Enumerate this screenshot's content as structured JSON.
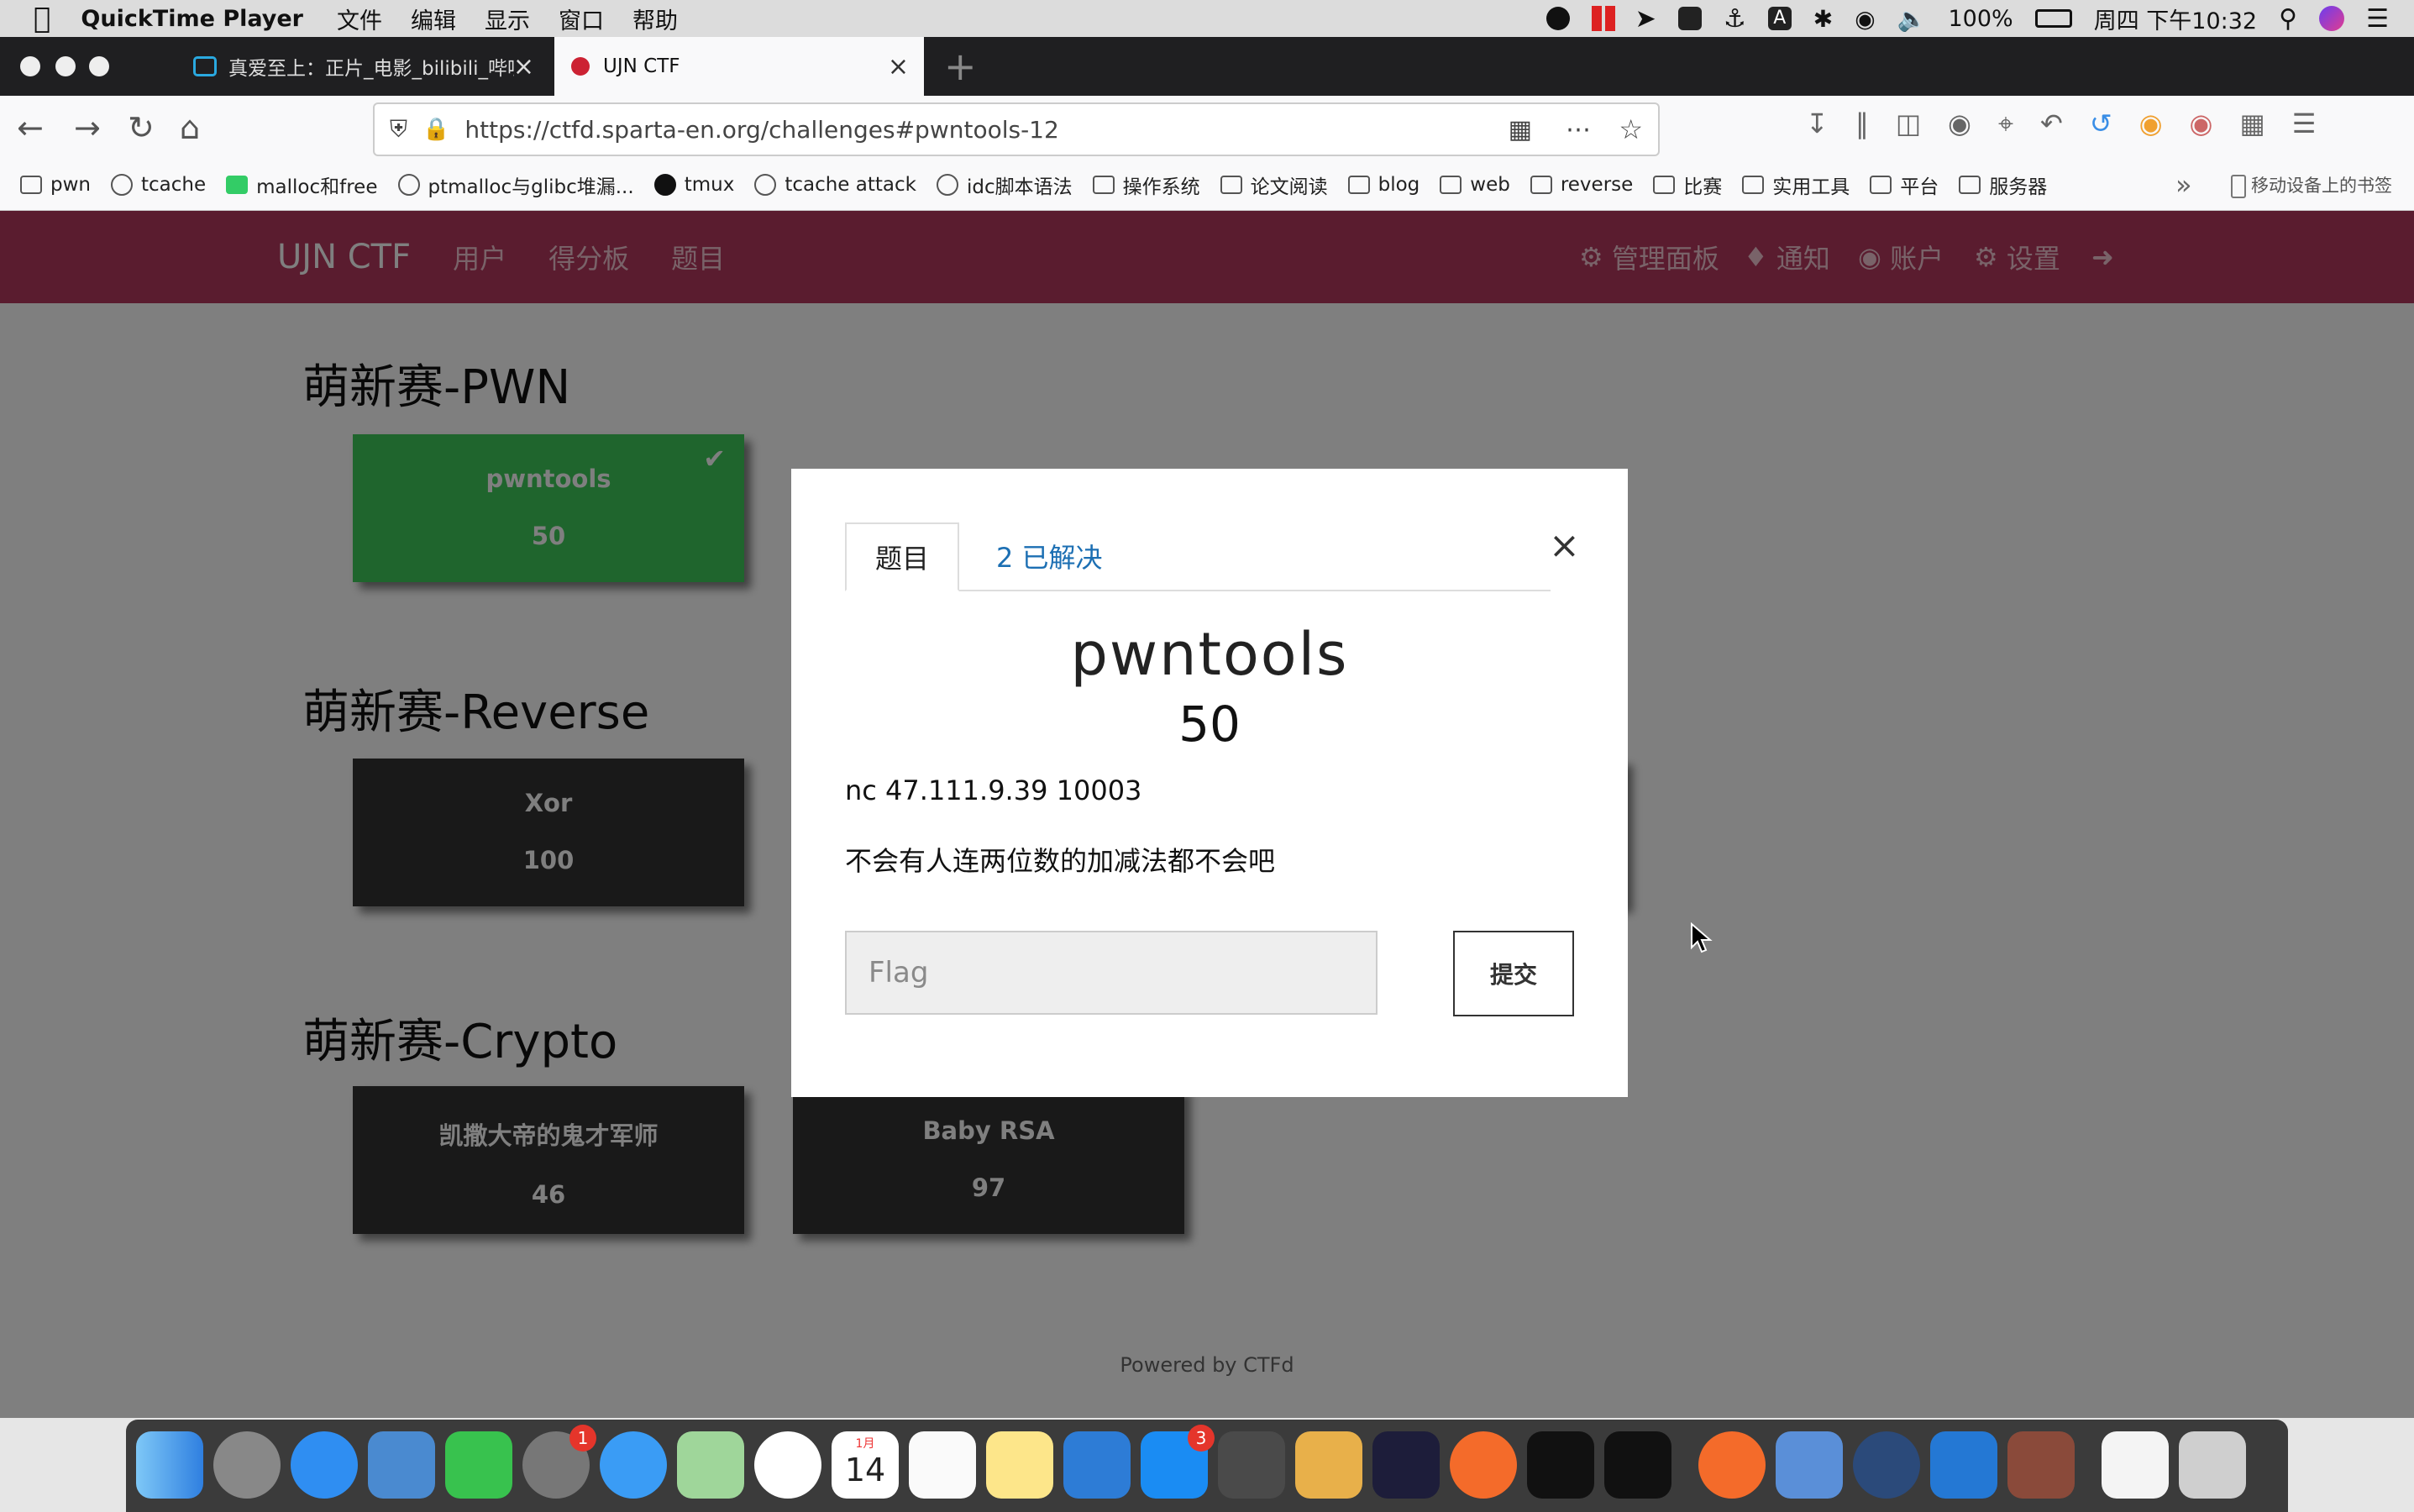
{
  "menubar": {
    "app_name": "QuickTime Player",
    "menus": [
      "文件",
      "编辑",
      "显示",
      "窗口",
      "帮助"
    ],
    "battery": "100%",
    "clock": "周四 下午10:32"
  },
  "browser": {
    "tabs": [
      {
        "label": "真爱至上：正片_电影_bilibili_哔哩"
      },
      {
        "label": "UJN CTF"
      }
    ],
    "url": "https://ctfd.sparta-en.org/challenges#pwntools-12",
    "bookmarks": [
      "pwn",
      "tcache",
      "malloc和free",
      "ptmalloc与glibc堆漏...",
      "tmux",
      "tcache attack",
      "idc脚本语法",
      "操作系统",
      "论文阅读",
      "blog",
      "web",
      "reverse",
      "比赛",
      "实用工具",
      "平台",
      "服务器"
    ],
    "mobile_bookmarks": "移动设备上的书签"
  },
  "ctf": {
    "brand": "UJN CTF",
    "nav_left": [
      "用户",
      "得分板",
      "题目"
    ],
    "nav_right": [
      "管理面板",
      "通知",
      "账户",
      "设置"
    ],
    "categories": [
      {
        "title": "萌新赛-PWN",
        "cards": [
          {
            "name": "pwntools",
            "value": "50"
          }
        ]
      },
      {
        "title": "萌新赛-Reverse",
        "cards": [
          {
            "name": "Xor",
            "value": "100"
          }
        ]
      },
      {
        "title": "萌新赛-Crypto",
        "cards": [
          {
            "name": "凯撒大帝的鬼才军师",
            "value": "46"
          },
          {
            "name": "Baby RSA",
            "value": "97"
          }
        ]
      }
    ],
    "footer": "Powered by CTFd"
  },
  "modal": {
    "tab_challenge": "题目",
    "tab_solves": "2 已解决",
    "title": "pwntools",
    "value": "50",
    "connection": "nc 47.111.9.39 10003",
    "description": "不会有人连两位数的加减法都不会吧",
    "flag_placeholder": "Flag",
    "submit_label": "提交"
  },
  "dock": {
    "calendar_month": "1月",
    "calendar_day": "14",
    "badge_settings": "1",
    "badge_appstore": "3"
  }
}
